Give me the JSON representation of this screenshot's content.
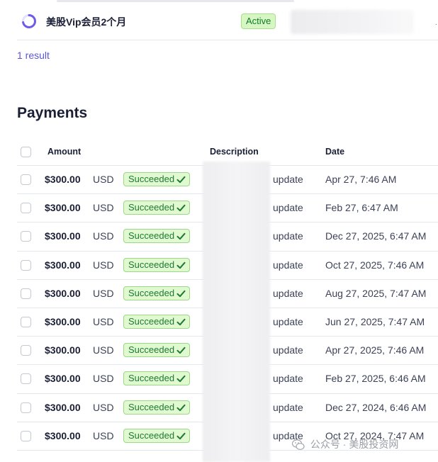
{
  "subscription": {
    "name": "美股Vip会员2个月",
    "status": "Active",
    "status_colors": {
      "bg": "#d7f7c2",
      "text": "#0f7a2b"
    },
    "icon": "partial-ring-icon"
  },
  "result_count": "1 result",
  "payments": {
    "title": "Payments",
    "columns": {
      "amount": "Amount",
      "description": "Description",
      "date": "Date"
    },
    "rows": [
      {
        "amount": "$300.00",
        "currency": "USD",
        "status": "Succeeded",
        "description": "update",
        "date": "Apr 27, 7:46 AM"
      },
      {
        "amount": "$300.00",
        "currency": "USD",
        "status": "Succeeded",
        "description": "update",
        "date": "Feb 27, 6:47 AM"
      },
      {
        "amount": "$300.00",
        "currency": "USD",
        "status": "Succeeded",
        "description": "update",
        "date": "Dec 27, 2025, 6:47 AM"
      },
      {
        "amount": "$300.00",
        "currency": "USD",
        "status": "Succeeded",
        "description": "update",
        "date": "Oct 27, 2025, 7:46 AM"
      },
      {
        "amount": "$300.00",
        "currency": "USD",
        "status": "Succeeded",
        "description": "update",
        "date": "Aug 27, 2025, 7:47 AM"
      },
      {
        "amount": "$300.00",
        "currency": "USD",
        "status": "Succeeded",
        "description": "update",
        "date": "Jun 27, 2025, 7:47 AM"
      },
      {
        "amount": "$300.00",
        "currency": "USD",
        "status": "Succeeded",
        "description": "update",
        "date": "Apr 27, 2025, 7:46 AM"
      },
      {
        "amount": "$300.00",
        "currency": "USD",
        "status": "Succeeded",
        "description": "update",
        "date": "Feb 27, 2025, 6:46 AM"
      },
      {
        "amount": "$300.00",
        "currency": "USD",
        "status": "Succeeded",
        "description": "update",
        "date": "Dec 27, 2024, 6:46 AM"
      },
      {
        "amount": "$300.00",
        "currency": "USD",
        "status": "Succeeded",
        "description": "update",
        "date": "Oct 27, 2024, 7:47 AM"
      }
    ],
    "status_colors": {
      "bg": "#e0f9d0",
      "text": "#1f7a32"
    }
  },
  "watermark": {
    "text": "公众号 · 美股投资网",
    "icon": "wechat-icon"
  }
}
